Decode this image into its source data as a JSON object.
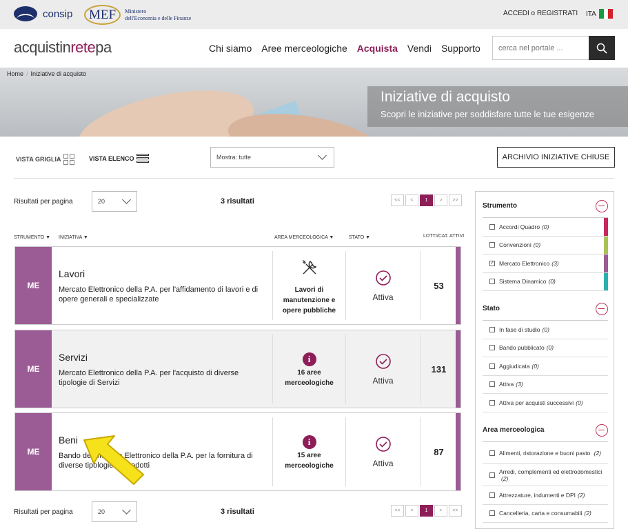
{
  "topbar": {
    "consip": "consip",
    "mef": "MEF",
    "mef_sub_1": "Ministero",
    "mef_sub_2": "dell'Economia e delle Finanze",
    "login": "ACCEDI o REGISTRATI",
    "lang": "ITA"
  },
  "header": {
    "brand_a": "acquistin",
    "brand_b": "rete",
    "brand_c": "pa",
    "nav": [
      "Chi siamo",
      "Aree merceologiche",
      "Acquista",
      "Vendi",
      "Supporto"
    ],
    "search_placeholder": "cerca nel portale ..."
  },
  "breadcrumb": {
    "home": "Home",
    "sep": "/",
    "current": "Iniziative di acquisto"
  },
  "hero": {
    "title": "Iniziative di acquisto",
    "subtitle": "Scopri le iniziative per soddisfare tutte le tue esigenze"
  },
  "viewbar": {
    "grid": "VISTA GRIGLIA",
    "list": "VISTA ELENCO",
    "show": "Mostra: tutte",
    "archive": "ARCHIVIO INIZIATIVE CHIUSE"
  },
  "list": {
    "perpage_label": "Risultati per pagina",
    "perpage_value": "20",
    "results": "3 risultati",
    "pager": [
      "<<",
      "<",
      "1",
      ">",
      ">>"
    ],
    "columns": [
      "STRUMENTO ▼",
      "INIZIATIVA ▼",
      "AREA MERCEOLOGICA ▼",
      "STATO ▼",
      "LOTTI/CAT. ATTIVI"
    ],
    "rows": [
      {
        "tag": "ME",
        "name": "Lavori",
        "desc": "Mercato Elettronico della P.A. per l'affidamento di lavori e di opere generali e specializzate",
        "area": "Lavori di manutenzione e opere pubbliche",
        "stato": "Attiva",
        "lotti": "53"
      },
      {
        "tag": "ME",
        "name": "Servizi",
        "desc": "Mercato Elettronico della P.A. per l'acquisto di diverse tipologie di Servizi",
        "area": "16 aree merceologiche",
        "stato": "Attiva",
        "lotti": "131"
      },
      {
        "tag": "ME",
        "name": "Beni",
        "desc": "Bando del Mercato Elettronico della P.A. per la fornitura di diverse tipologie di Prodotti",
        "area": "15 aree merceologiche",
        "stato": "Attiva",
        "lotti": "87"
      }
    ]
  },
  "filters": {
    "strumento": {
      "title": "Strumento",
      "items": [
        {
          "label": "Accordi Quadro",
          "count": "(0)",
          "color": "#c7285e"
        },
        {
          "label": "Convenzioni",
          "count": "(0)",
          "color": "#a8c256"
        },
        {
          "label": "Mercato Elettronico",
          "count": "(3)",
          "color": "#9b5b95"
        },
        {
          "label": "Sistema Dinamico",
          "count": "(0)",
          "color": "#2bb0b0"
        }
      ]
    },
    "stato": {
      "title": "Stato",
      "items": [
        {
          "label": "In fase di studio",
          "count": "(0)"
        },
        {
          "label": "Bando pubblicato",
          "count": "(0)"
        },
        {
          "label": "Aggiudicata",
          "count": "(0)"
        },
        {
          "label": "Attiva",
          "count": "(3)"
        },
        {
          "label": "Attiva per acquisti successivi",
          "count": "(0)"
        }
      ]
    },
    "area": {
      "title": "Area merceologica",
      "items": [
        {
          "label": "Alimenti, ristorazione e buoni pasto",
          "count": "(2)"
        },
        {
          "label": "Arredi, complementi ed elettrodomestici",
          "count": "(2)"
        },
        {
          "label": "Attrezzature, indumenti e DPI",
          "count": "(2)"
        },
        {
          "label": "Cancelleria, carta e consumabili",
          "count": "(2)"
        }
      ]
    }
  },
  "colors": {
    "brand": "#8e1e58",
    "me": "#9b5b95",
    "dark": "#2b2b2b"
  }
}
